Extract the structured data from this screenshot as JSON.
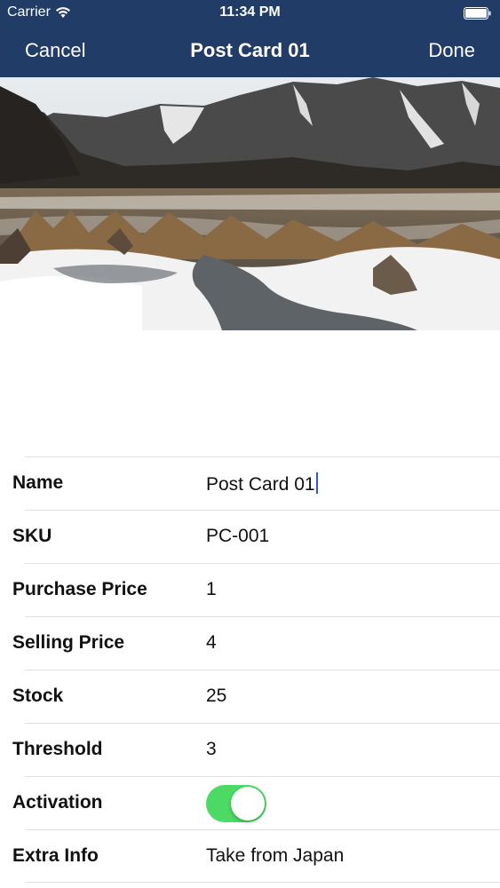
{
  "status_bar": {
    "carrier": "Carrier",
    "time": "11:34 PM",
    "wifi_icon": "wifi-icon",
    "battery_icon": "battery-icon",
    "battery_level": 1.0
  },
  "nav": {
    "cancel_label": "Cancel",
    "title": "Post Card 01",
    "done_label": "Done",
    "background_color": "#213c66"
  },
  "photo": {
    "subject": "snowy mountain landscape"
  },
  "form": {
    "rows": [
      {
        "label": "Name",
        "value": "Post Card 01",
        "editing": true
      },
      {
        "label": "SKU",
        "value": "PC-001"
      },
      {
        "label": "Purchase Price",
        "value": "1"
      },
      {
        "label": "Selling Price",
        "value": "4"
      },
      {
        "label": "Stock",
        "value": "25"
      },
      {
        "label": "Threshold",
        "value": "3"
      },
      {
        "label": "Activation",
        "toggle_on": true,
        "toggle_color": "#4cd964"
      },
      {
        "label": "Extra Info",
        "value": "Take from Japan"
      }
    ]
  }
}
